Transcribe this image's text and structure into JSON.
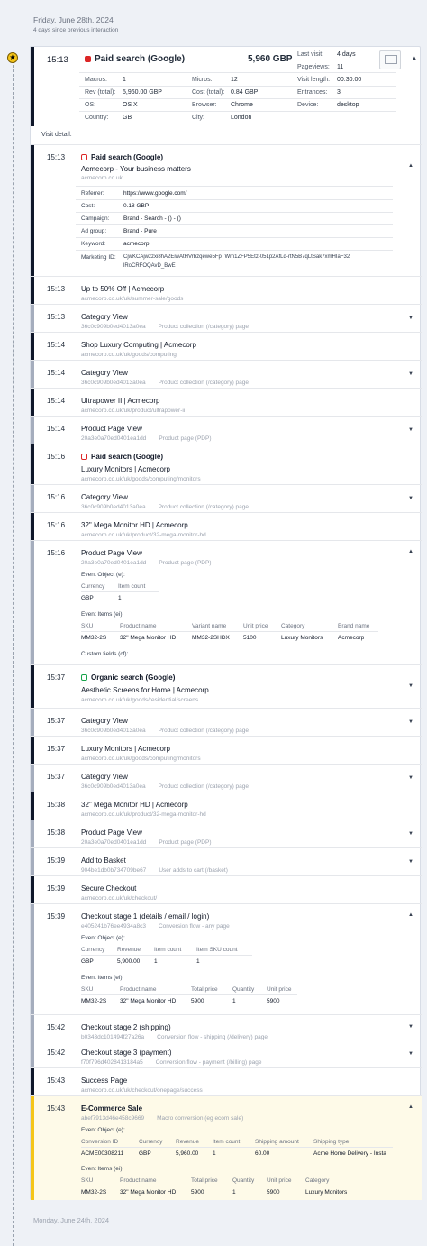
{
  "header": {
    "date": "Friday, June 28th, 2024",
    "since": "4 days since previous interaction"
  },
  "session": {
    "time": "15:13",
    "title": "Paid search (Google)",
    "value": "5,960 GBP",
    "last_visit_k": "Last visit:",
    "last_visit_v": "4 days",
    "pageviews_k": "Pageviews:",
    "pageviews_v": "11",
    "visit_len_k": "Visit length:",
    "visit_len_v": "00:30:00",
    "entrances_k": "Entrances:",
    "entrances_v": "3",
    "device_k": "Device:",
    "device_v": "desktop",
    "macros_k": "Macros:",
    "macros_v": "1",
    "micros_k": "Micros:",
    "micros_v": "12",
    "rev_k": "Rev (total):",
    "rev_v": "5,960.00 GBP",
    "cost_k": "Cost (total):",
    "cost_v": "0.84 GBP",
    "os_k": "OS:",
    "os_v": "OS X",
    "browser_k": "Browser:",
    "browser_v": "Chrome",
    "country_k": "Country:",
    "country_v": "GB",
    "city_k": "City:",
    "city_v": "London",
    "visit_detail": "Visit detail:"
  },
  "first": {
    "time": "15:13",
    "source": "Paid search (Google)",
    "title": "Acmecorp - Your business matters",
    "url": "acmecorp.co.uk",
    "referrer_k": "Referrer:",
    "referrer_v": "https://www.google.com/",
    "cost_k": "Cost:",
    "cost_v": "0.18 GBP",
    "campaign_k": "Campaign:",
    "campaign_v": "Brand - Search - () - ()",
    "adgroup_k": "Ad group:",
    "adgroup_v": "Brand - Pure",
    "keyword_k": "Keyword:",
    "keyword_v": "acmecorp",
    "mid_k": "Marketing ID:",
    "mid_v1": "CjwKCAjwzzxi8hA2EiwAtHVrbzqewe5FpTWm1ZFP5Etz-05Lp2AfLd-rtN5B7qLtSak7xmHIaF32",
    "mid_v2": "lRoCRFOQAvD_BwE"
  },
  "rows": [
    {
      "time": "15:13",
      "title": "Up to 50% Off | Acmecorp",
      "d1": "acmecorp.co.uk/uk/summer-sale/goods",
      "d2": ""
    },
    {
      "time": "15:13",
      "title": "Category View",
      "d1": "36c0c909b0ed4013a0ea",
      "d2": "Product collection (/category) page"
    },
    {
      "time": "15:14",
      "title": "Shop Luxury Computing | Acmecorp",
      "d1": "acmecorp.co.uk/uk/goods/computing",
      "d2": ""
    },
    {
      "time": "15:14",
      "title": "Category View",
      "d1": "36c0c909b0ed4013a0ea",
      "d2": "Product collection (/category) page"
    },
    {
      "time": "15:14",
      "title": "Ultrapower II | Acmecorp",
      "d1": "acmecorp.co.uk/uk/product/ultrapower-ii",
      "d2": ""
    },
    {
      "time": "15:14",
      "title": "Product Page View",
      "d1": "20a3e0a70ed0401ea1dd",
      "d2": "Product page (PDP)"
    },
    {
      "time": "15:16",
      "title": "Luxury Monitors | Acmecorp",
      "d1": "acmecorp.co.uk/uk/goods/computing/monitors",
      "d2": "",
      "source": "Paid search (Google)"
    },
    {
      "time": "15:16",
      "title": "Category View",
      "d1": "36c0c909b0ed4013a0ea",
      "d2": "Product collection (/category) page"
    },
    {
      "time": "15:16",
      "title": "32\" Mega Monitor HD | Acmecorp",
      "d1": "acmecorp.co.uk/uk/product/32-mega-monitor-hd",
      "d2": ""
    }
  ],
  "pdp": {
    "time": "15:16",
    "title": "Product Page View",
    "d1": "20a3e0a70ed0401ea1dd",
    "d2": "Product page (PDP)",
    "eo": "Event Object (e):",
    "currency_h": "Currency",
    "itemcount_h": "Item count",
    "currency": "GBP",
    "itemcount": "1",
    "ei": "Event Items (ei):",
    "h_sku": "SKU",
    "h_pn": "Product name",
    "h_vn": "Variant name",
    "h_up": "Unit price",
    "h_cat": "Category",
    "h_bn": "Brand name",
    "sku": "MM32-2S",
    "pn": "32\" Mega Monitor HD",
    "vn": "MM32-2SHDX",
    "up": "5100",
    "cat": "Luxury Monitors",
    "bn": "Acmecorp",
    "cf": "Custom fields (cf):"
  },
  "rows2": [
    {
      "time": "15:37",
      "title": "Aesthetic Screens for Home | Acmecorp",
      "d1": "acmecorp.co.uk/uk/goods/residential/screens",
      "d2": "",
      "source": "Organic search (Google)"
    },
    {
      "time": "15:37",
      "title": "Category View",
      "d1": "36c0c909b0ed4013a0ea",
      "d2": "Product collection (/category) page"
    },
    {
      "time": "15:37",
      "title": "Luxury Monitors | Acmecorp",
      "d1": "acmecorp.co.uk/uk/goods/computing/monitors",
      "d2": ""
    },
    {
      "time": "15:37",
      "title": "Category View",
      "d1": "36c0c909b0ed4013a0ea",
      "d2": "Product collection (/category) page"
    },
    {
      "time": "15:38",
      "title": "32\" Mega Monitor HD | Acmecorp",
      "d1": "acmecorp.co.uk/uk/product/32-mega-monitor-hd",
      "d2": ""
    },
    {
      "time": "15:38",
      "title": "Product Page View",
      "d1": "20a3e0a70ed0401ea1dd",
      "d2": "Product page (PDP)"
    },
    {
      "time": "15:39",
      "title": "Add to Basket",
      "d1": "904be1db0b734709be67",
      "d2": "User adds to cart (/basket)"
    },
    {
      "time": "15:39",
      "title": "Secure Checkout",
      "d1": "acmecorp.co.uk/uk/checkout/",
      "d2": ""
    }
  ],
  "checkout1": {
    "time": "15:39",
    "title": "Checkout stage 1 (details / email / login)",
    "d1": "e405241b76ee4934a8c3",
    "d2": "Conversion flow - any page",
    "eo": "Event Object (e):",
    "h_cur": "Currency",
    "h_rev": "Revenue",
    "h_ic": "Item count",
    "h_isc": "Item SKU count",
    "cur": "GBP",
    "rev": "5,900.00",
    "ic": "1",
    "isc": "1",
    "ei": "Event Items (ei):",
    "h_sku": "SKU",
    "h_pn": "Product name",
    "h_tp": "Total price",
    "h_q": "Quantity",
    "h_up": "Unit price",
    "sku": "MM32-2S",
    "pn": "32\" Mega Monitor HD",
    "tp": "5900",
    "q": "1",
    "up": "5900"
  },
  "rows3": [
    {
      "time": "15:42",
      "title": "Checkout stage 2 (shipping)",
      "d1": "b0343dc101494f27a26a",
      "d2": "Conversion flow - shipping (/delivery) page"
    },
    {
      "time": "15:42",
      "title": "Checkout stage 3 (payment)",
      "d1": "f70f796d4028413184a5",
      "d2": "Conversion flow - payment (/billing) page"
    },
    {
      "time": "15:43",
      "title": "Success Page",
      "d1": "acmecorp.co.uk/uk/checkout/onepage/success",
      "d2": ""
    }
  ],
  "ecom": {
    "time": "15:43",
    "title": "E-Commerce Sale",
    "d1": "abef7913d46e458c9669",
    "d2": "Macro conversion (eg ecom sale)",
    "eo": "Event Object (e):",
    "h_cid": "Conversion ID",
    "h_cur": "Currency",
    "h_rev": "Revenue",
    "h_ic": "Item count",
    "h_sa": "Shipping amount",
    "h_st": "Shipping type",
    "cid": "ACME00308211",
    "cur": "GBP",
    "rev": "5,960.00",
    "ic": "1",
    "sa": "60.00",
    "st": "Acme Home Delivery - Insta",
    "ei": "Event Items (ei):",
    "h_sku": "SKU",
    "h_pn": "Product name",
    "h_tp": "Total price",
    "h_q": "Quantity",
    "h_up": "Unit price",
    "h_cat": "Category",
    "sku": "MM32-2S",
    "pn": "32\" Mega Monitor HD",
    "tp": "5900",
    "q": "1",
    "up": "5900",
    "cat": "Luxury Monitors"
  },
  "footer": {
    "date": "Monday, June 24th, 2024"
  },
  "colors": {
    "dark": "#0f172a",
    "gray": "#a5adbd",
    "paid": "#dc2626",
    "organic": "#16a34a",
    "sale": "#f5c518",
    "sale_bg": "#fefae8"
  }
}
